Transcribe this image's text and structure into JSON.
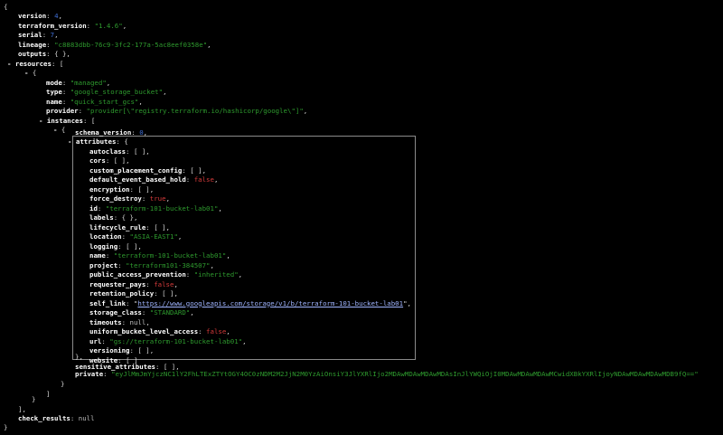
{
  "json_viewer": {
    "open_brace": "{",
    "close_brace": "}",
    "open_bracket": "[",
    "close_bracket": "]",
    "empty_object": "{ },",
    "empty_array": "[ ],",
    "collapse_toggle": "-",
    "root": {
      "version_key": "version",
      "version_value": "4",
      "terraform_version_key": "terraform_version",
      "terraform_version_value": "\"1.4.6\"",
      "serial_key": "serial",
      "serial_value": "7",
      "lineage_key": "lineage",
      "lineage_value": "\"c8883dbb-76c9-3fc2-177a-5ac8eef0358e\"",
      "outputs_key": "outputs",
      "resources_key": "resources",
      "check_results_key": "check_results",
      "check_results_value": "null"
    },
    "resource": {
      "mode_key": "mode",
      "mode_value": "\"managed\"",
      "type_key": "type",
      "type_value": "\"google_storage_bucket\"",
      "name_key": "name",
      "name_value": "\"quick_start_gcs\"",
      "provider_key": "provider",
      "provider_value": "\"provider[\\\"registry.terraform.io/hashicorp/google\\\"]\"",
      "instances_key": "instances"
    },
    "instance": {
      "schema_version_key": "schema_version",
      "schema_version_value": "0",
      "attributes_key": "attributes",
      "sensitive_attributes_key": "sensitive_attributes",
      "private_key": "private",
      "private_value": "\"eyJlMmJmYjczNC1lY2FhLTExZTYtOGY4OC0zNDM2M2JjN2M0YzAiOnsiY3JlYXRlIjo2MDAwMDAwMDAwMDAsInJlYWQiOjI0MDAwMDAwMDAwMCwidXBkYXRlIjoyNDAwMDAwMDAwMDB9fQ==\""
    },
    "attributes": {
      "autoclass_key": "autoclass",
      "cors_key": "cors",
      "custom_placement_config_key": "custom_placement_config",
      "default_event_based_hold_key": "default_event_based_hold",
      "default_event_based_hold_value": "false",
      "encryption_key": "encryption",
      "force_destroy_key": "force_destroy",
      "force_destroy_value": "true",
      "id_key": "id",
      "id_value": "\"terraform-101-bucket-lab01\"",
      "labels_key": "labels",
      "lifecycle_rule_key": "lifecycle_rule",
      "location_key": "location",
      "location_value": "\"ASIA-EAST1\"",
      "logging_key": "logging",
      "name_key": "name",
      "name_value": "\"terraform-101-bucket-lab01\"",
      "project_key": "project",
      "project_value": "\"terraform101-384507\"",
      "public_access_prevention_key": "public_access_prevention",
      "public_access_prevention_value": "\"inherited\"",
      "requester_pays_key": "requester_pays",
      "requester_pays_value": "false",
      "retention_policy_key": "retention_policy",
      "self_link_key": "self_link",
      "self_link_value": "https://www.googleapis.com/storage/v1/b/terraform-101-bucket-lab01",
      "storage_class_key": "storage_class",
      "storage_class_value": "\"STANDARD\"",
      "timeouts_key": "timeouts",
      "timeouts_value": "null",
      "uniform_bucket_level_access_key": "uniform_bucket_level_access",
      "uniform_bucket_level_access_value": "false",
      "url_key": "url",
      "url_value": "\"gs://terraform-101-bucket-lab01\"",
      "versioning_key": "versioning",
      "website_key": "website"
    }
  }
}
